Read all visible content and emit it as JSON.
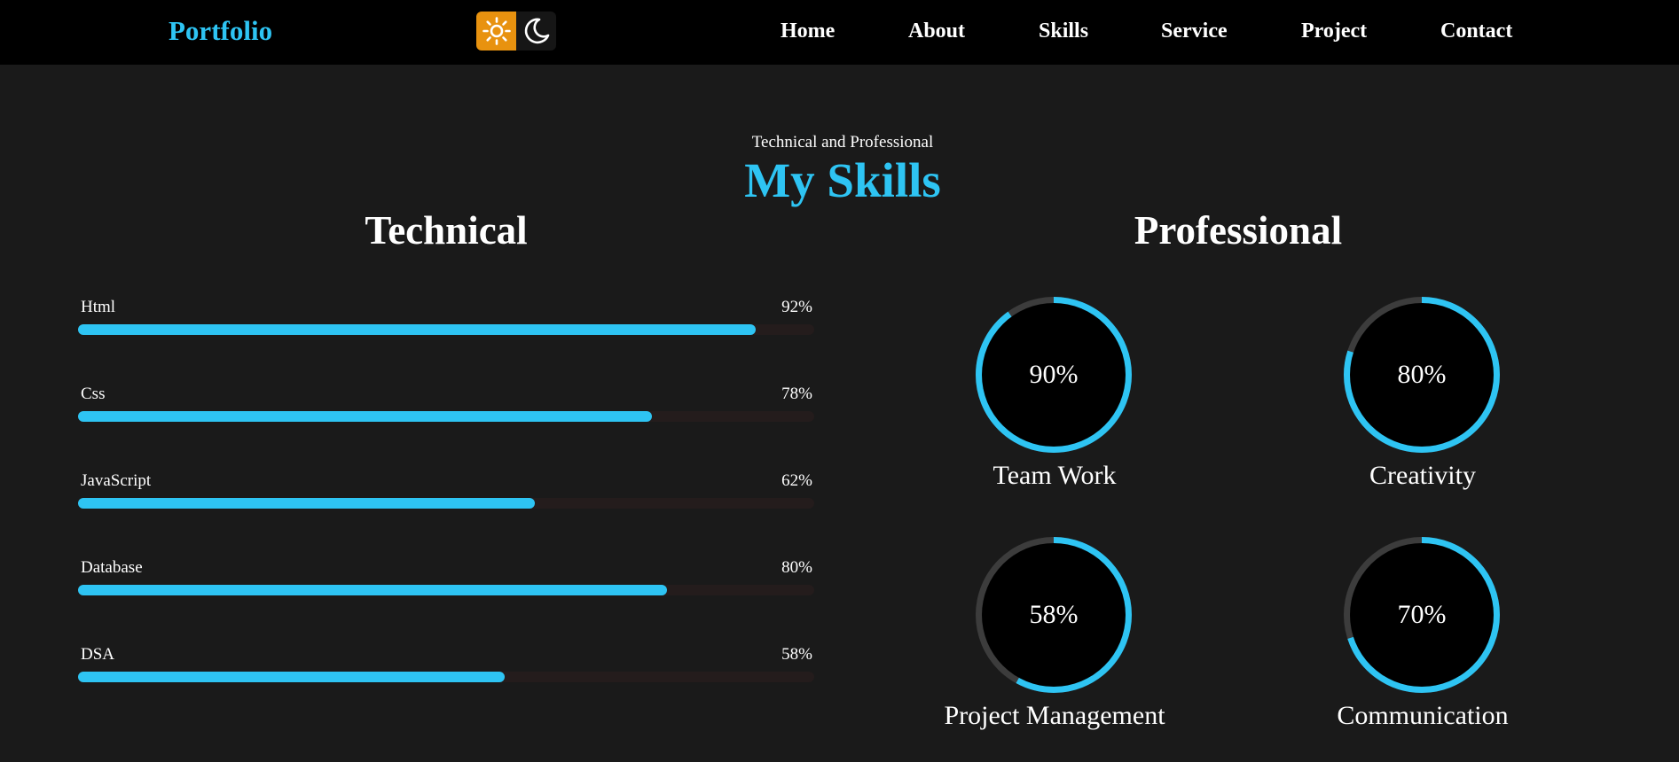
{
  "navbar": {
    "logo": "Portfolio",
    "links": [
      "Home",
      "About",
      "Skills",
      "Service",
      "Project",
      "Contact"
    ]
  },
  "theme_toggle": {
    "light_icon": "sun-icon",
    "dark_icon": "moon-icon",
    "light_color": "#e8920f",
    "dark_color": "#161616"
  },
  "skills": {
    "subtitle": "Technical and Professional",
    "title": "My Skills",
    "technical_heading": "Technical",
    "professional_heading": "Professional",
    "technical": [
      {
        "name": "Html",
        "percent_label": "92%",
        "fraction": 0.92
      },
      {
        "name": "Css",
        "percent_label": "78%",
        "fraction": 0.78
      },
      {
        "name": "JavaScript",
        "percent_label": "62%",
        "fraction": 0.62
      },
      {
        "name": "Database",
        "percent_label": "80%",
        "fraction": 0.8
      },
      {
        "name": "DSA",
        "percent_label": "58%",
        "fraction": 0.58
      }
    ],
    "professional": [
      {
        "name": "Team Work",
        "percent_label": "90%",
        "fraction": 0.9
      },
      {
        "name": "Creativity",
        "percent_label": "80%",
        "fraction": 0.8
      },
      {
        "name": "Project Management",
        "percent_label": "58%",
        "fraction": 0.58
      },
      {
        "name": "Communication",
        "percent_label": "70%",
        "fraction": 0.7
      }
    ]
  },
  "colors": {
    "accent": "#2ec4f3",
    "page_background": "#1a1a1a",
    "navbar_background": "#000000",
    "bar_track": "#241c1c",
    "ring_track": "#3c3c3c"
  }
}
